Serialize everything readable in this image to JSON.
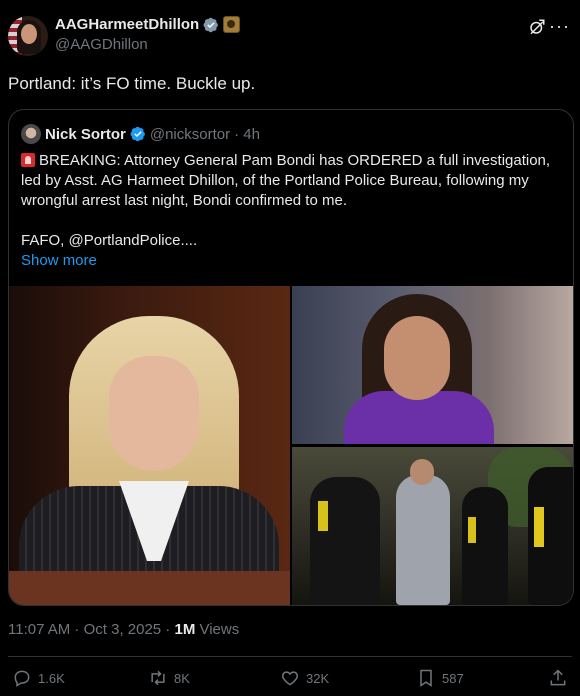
{
  "author": {
    "display_name": "AAGHarmeetDhillon",
    "handle": "@AAGDhillon"
  },
  "icons": {
    "verified": "verified-badge-icon",
    "affiliation": "government-seal-icon",
    "grok": "grok-icon",
    "more": "more-icon"
  },
  "tweet": {
    "text": "Portland: it’s FO time. Buckle up."
  },
  "quote": {
    "display_name": "Nick Sortor",
    "handle": "@nicksortor",
    "time": "· 4h",
    "paragraph1": "BREAKING: Attorney General Pam Bondi has ORDERED a full investigation, led by Asst. AG Harmeet Dhillon, of the Portland Police Bureau, following my wrongful arrest last night, Bondi confirmed to me.",
    "paragraph2": "FAFO, @PortlandPolice....",
    "show_more": "Show more",
    "emoji_name": "police-siren-icon"
  },
  "meta": {
    "timestamp": "11:07 AM · Oct 3, 2025 · ",
    "views_count": "1M",
    "views_label": " Views"
  },
  "actions": {
    "replies": "1.6K",
    "reposts": "8K",
    "likes": "32K",
    "bookmarks": "587"
  },
  "colors": {
    "background": "#000000",
    "text": "#e7e9ea",
    "muted": "#71767b",
    "accent": "#1d9bf0",
    "border": "#2f3336"
  }
}
